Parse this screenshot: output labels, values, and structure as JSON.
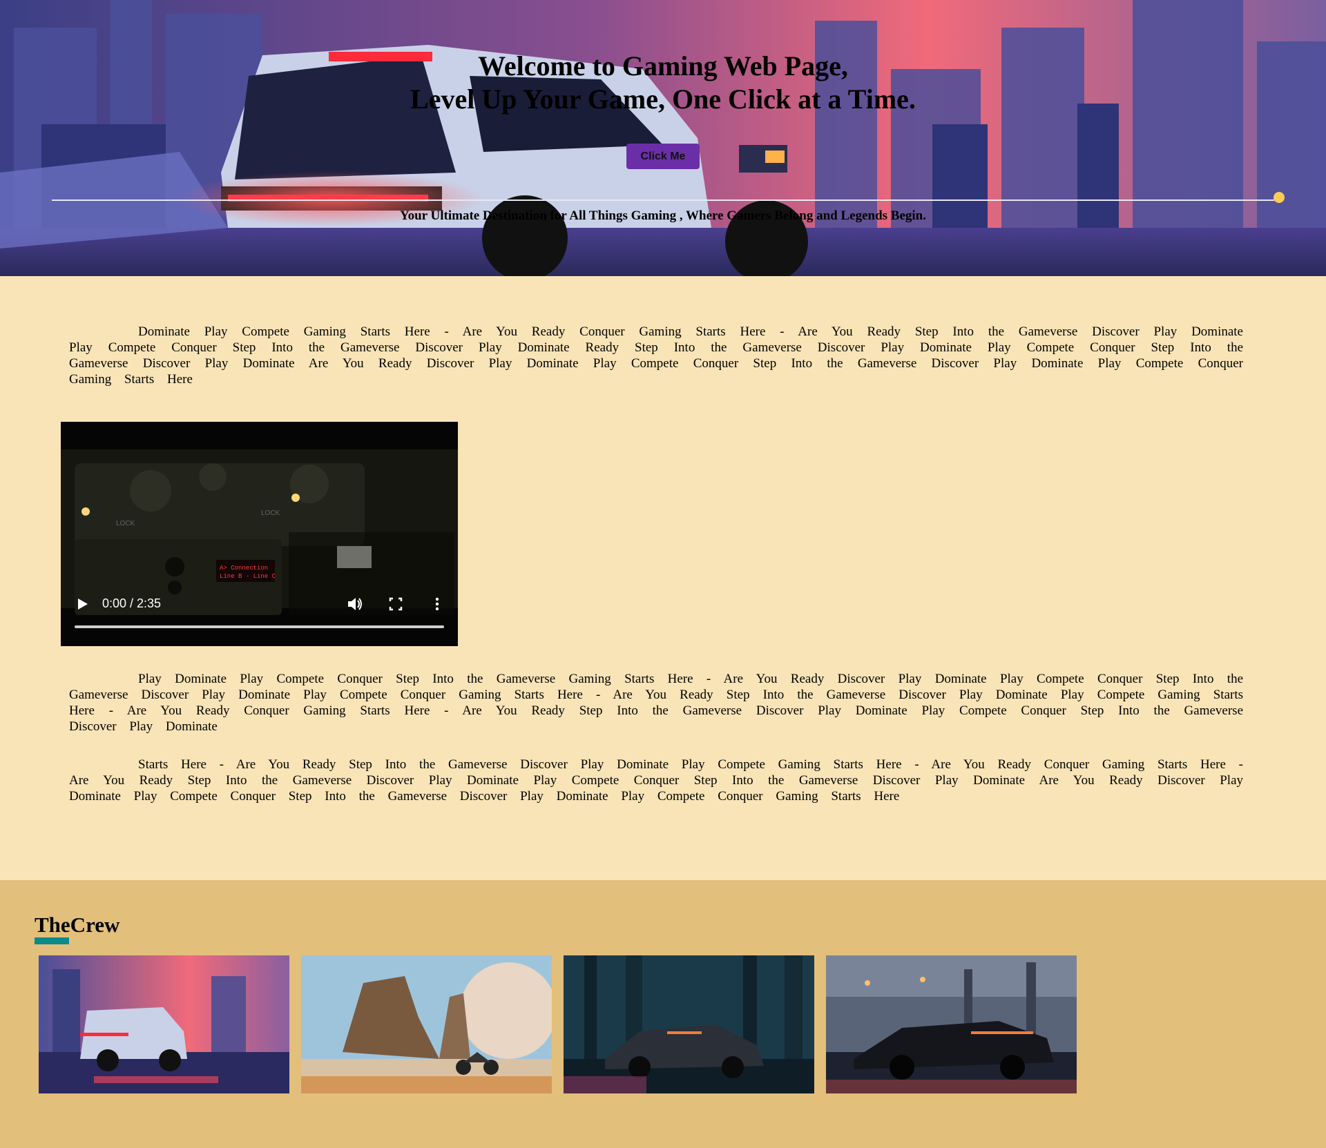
{
  "hero": {
    "title_line1": "Welcome to Gaming Web Page,",
    "title_line2": "Level Up Your Game, One Click at a Time.",
    "button_label": "Click Me",
    "tagline": "Your Ultimate Destination for All Things Gaming , Where Gamers Belong and Legends Begin."
  },
  "paragraphs": {
    "p1": "Dominate Play Compete Gaming Starts Here - Are You Ready Conquer Gaming Starts Here - Are You Ready Step Into the Gameverse Discover Play Dominate Play Compete Conquer Step Into the Gameverse Discover Play Dominate Ready Step Into the Gameverse Discover Play Dominate Play Compete Conquer Step Into the Gameverse Discover Play Dominate Are You Ready Discover Play Dominate Play Compete Conquer Step Into the Gameverse Discover Play Dominate Play Compete Conquer Gaming Starts Here",
    "p2": "Play Dominate Play Compete Conquer Step Into the Gameverse Gaming Starts Here - Are You Ready Discover Play Dominate Play Compete Conquer Step Into the Gameverse Discover Play Dominate Play Compete Conquer Gaming Starts Here - Are You Ready Step Into the Gameverse Discover Play Dominate Play Compete Gaming Starts Here - Are You Ready Conquer Gaming Starts Here - Are You Ready Step Into the Gameverse Discover Play Dominate Play Compete Conquer Step Into the Gameverse Discover Play Dominate",
    "p3": "Starts Here - Are You Ready Step Into the Gameverse Discover Play Dominate Play Compete Gaming Starts Here - Are You Ready Conquer Gaming Starts Here - Are You Ready Step Into the Gameverse Discover Play Dominate Play Compete Conquer Step Into the Gameverse Discover Play Dominate Are You Ready Discover Play Dominate Play Compete Conquer Step Into the Gameverse Discover Play Dominate Play Compete Conquer Gaming Starts Here"
  },
  "video": {
    "time": "0:00 / 2:35",
    "progress": 0,
    "screen_text_line1": "A> Connection",
    "screen_text_line2": "Line B - Line C",
    "panel_label_a": "LOCK",
    "panel_label_b": "LOCK",
    "icons": [
      "play-icon",
      "volume-icon",
      "fullscreen-icon",
      "more-icon"
    ]
  },
  "crew": {
    "title": "TheCrew",
    "accent_color": "#0b8a8a",
    "images": [
      "cyber-truck-city",
      "desert-moto-planet",
      "forest-car",
      "rain-supercar"
    ]
  },
  "colors": {
    "page_bg": "#f9e4b7",
    "crew_bg": "#e3bf7c",
    "button_bg": "#6a2fa6"
  }
}
